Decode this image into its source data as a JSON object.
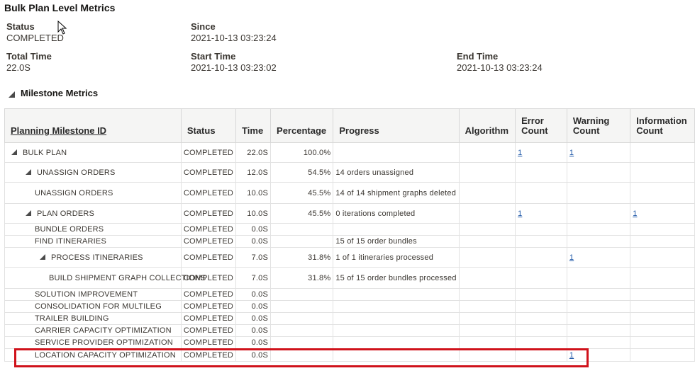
{
  "page": {
    "title": "Bulk Plan Level Metrics"
  },
  "summary": {
    "status_label": "Status",
    "status_value": "COMPLETED",
    "since_label": "Since",
    "since_value": "2021-10-13 03:23:24",
    "total_time_label": "Total Time",
    "total_time_value": "22.0S",
    "start_time_label": "Start Time",
    "start_time_value": "2021-10-13 03:23:02",
    "end_time_label": "End Time",
    "end_time_value": "2021-10-13 03:23:24"
  },
  "milestones": {
    "section_title": "Milestone Metrics",
    "columns": [
      "Planning Milestone ID",
      "Status",
      "Time",
      "Percentage",
      "Progress",
      "Algorithm",
      "Error Count",
      "Warning Count",
      "Information Count"
    ],
    "rows": [
      {
        "id": "BULK PLAN",
        "level": 0,
        "expandable": true,
        "status": "COMPLETED",
        "time": "22.0S",
        "percentage": "100.0%",
        "progress": "",
        "algorithm": "",
        "error": "1",
        "warning": "1",
        "info": ""
      },
      {
        "id": "UNASSIGN ORDERS",
        "level": 1,
        "expandable": true,
        "status": "COMPLETED",
        "time": "12.0S",
        "percentage": "54.5%",
        "progress": "14 orders unassigned",
        "algorithm": "",
        "error": "",
        "warning": "",
        "info": ""
      },
      {
        "id": "UNASSIGN ORDERS",
        "level": 2,
        "expandable": false,
        "status": "COMPLETED",
        "time": "10.0S",
        "percentage": "45.5%",
        "progress": "14 of 14 shipment graphs deleted",
        "algorithm": "",
        "error": "",
        "warning": "",
        "info": ""
      },
      {
        "id": "PLAN ORDERS",
        "level": 1,
        "expandable": true,
        "status": "COMPLETED",
        "time": "10.0S",
        "percentage": "45.5%",
        "progress": "0 iterations completed",
        "algorithm": "",
        "error": "1",
        "warning": "",
        "info": "1"
      },
      {
        "id": "BUNDLE ORDERS",
        "level": 2,
        "expandable": false,
        "status": "COMPLETED",
        "time": "0.0S",
        "percentage": "",
        "progress": "",
        "algorithm": "",
        "error": "",
        "warning": "",
        "info": ""
      },
      {
        "id": "FIND ITINERARIES",
        "level": 2,
        "expandable": false,
        "status": "COMPLETED",
        "time": "0.0S",
        "percentage": "",
        "progress": "15 of 15 order bundles",
        "algorithm": "",
        "error": "",
        "warning": "",
        "info": ""
      },
      {
        "id": "PROCESS ITINERARIES",
        "level": 3,
        "expandable": true,
        "status": "COMPLETED",
        "time": "7.0S",
        "percentage": "31.8%",
        "progress": "1 of 1 itineraries processed",
        "algorithm": "",
        "error": "",
        "warning": "1",
        "info": ""
      },
      {
        "id": "BUILD SHIPMENT GRAPH COLLECTIONS",
        "level": 4,
        "expandable": false,
        "status": "COMPLETED",
        "time": "7.0S",
        "percentage": "31.8%",
        "progress": "15 of 15 order bundles processed",
        "algorithm": "",
        "error": "",
        "warning": "",
        "info": ""
      },
      {
        "id": "SOLUTION IMPROVEMENT",
        "level": 2,
        "expandable": false,
        "status": "COMPLETED",
        "time": "0.0S",
        "percentage": "",
        "progress": "",
        "algorithm": "",
        "error": "",
        "warning": "",
        "info": ""
      },
      {
        "id": "CONSOLIDATION FOR MULTILEG",
        "level": 2,
        "expandable": false,
        "status": "COMPLETED",
        "time": "0.0S",
        "percentage": "",
        "progress": "",
        "algorithm": "",
        "error": "",
        "warning": "",
        "info": ""
      },
      {
        "id": "TRAILER BUILDING",
        "level": 2,
        "expandable": false,
        "status": "COMPLETED",
        "time": "0.0S",
        "percentage": "",
        "progress": "",
        "algorithm": "",
        "error": "",
        "warning": "",
        "info": ""
      },
      {
        "id": "CARRIER CAPACITY OPTIMIZATION",
        "level": 2,
        "expandable": false,
        "status": "COMPLETED",
        "time": "0.0S",
        "percentage": "",
        "progress": "",
        "algorithm": "",
        "error": "",
        "warning": "",
        "info": ""
      },
      {
        "id": "SERVICE PROVIDER OPTIMIZATION",
        "level": 2,
        "expandable": false,
        "status": "COMPLETED",
        "time": "0.0S",
        "percentage": "",
        "progress": "",
        "algorithm": "",
        "error": "",
        "warning": "",
        "info": ""
      },
      {
        "id": "LOCATION CAPACITY OPTIMIZATION",
        "level": 2,
        "expandable": false,
        "status": "COMPLETED",
        "time": "0.0S",
        "percentage": "",
        "progress": "",
        "algorithm": "",
        "error": "",
        "warning": "1",
        "info": ""
      }
    ]
  },
  "colors": {
    "link": "#1f58a8",
    "highlight_border": "#d0121b",
    "header_bg": "#f5f5f4"
  }
}
